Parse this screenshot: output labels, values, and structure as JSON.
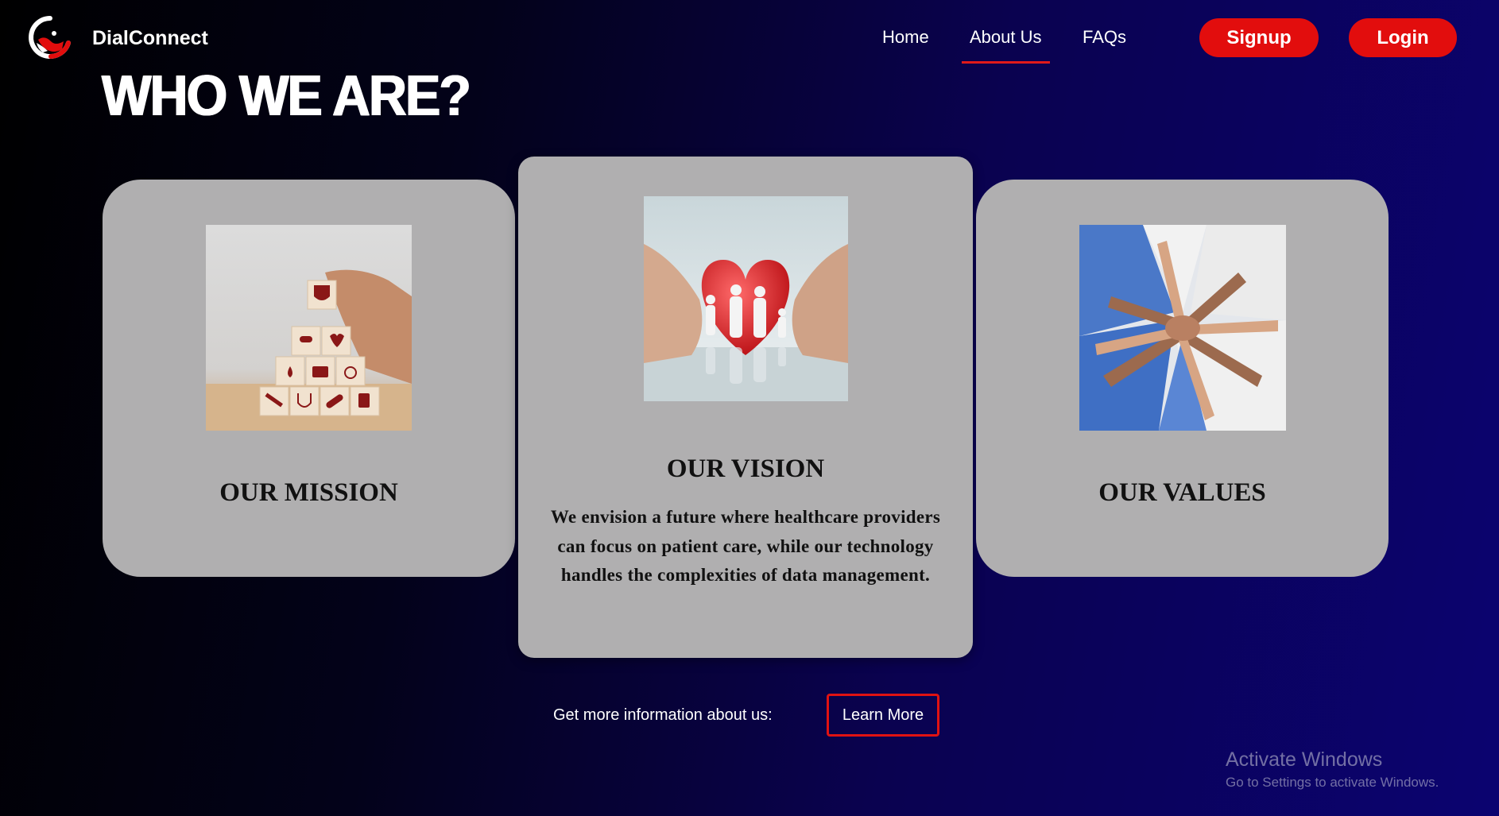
{
  "header": {
    "brand": "DialConnect",
    "nav": [
      {
        "label": "Home",
        "active": false
      },
      {
        "label": "About Us",
        "active": true
      },
      {
        "label": "FAQs",
        "active": false
      }
    ],
    "signup_label": "Signup",
    "login_label": "Login"
  },
  "hero": {
    "title": "WHO WE ARE?"
  },
  "cards": {
    "mission": {
      "title": "OUR MISSION",
      "image": "medical-icon-blocks-photo"
    },
    "vision": {
      "title": "OUR VISION",
      "image": "hands-heart-family-photo",
      "description": "We envision a future where healthcare providers can focus on patient care, while our technology handles the complexities of data management."
    },
    "values": {
      "title": "OUR VALUES",
      "image": "stacked-hands-team-photo"
    }
  },
  "cta": {
    "text": "Get more information about us:",
    "button_label": "Learn More"
  },
  "watermark": {
    "title": "Activate Windows",
    "subtitle": "Go to Settings to activate Windows."
  },
  "colors": {
    "accent": "#e20d0d",
    "card_bg": "#b0afb0",
    "bg_dark": "#000000",
    "bg_navy": "#0b0370"
  }
}
